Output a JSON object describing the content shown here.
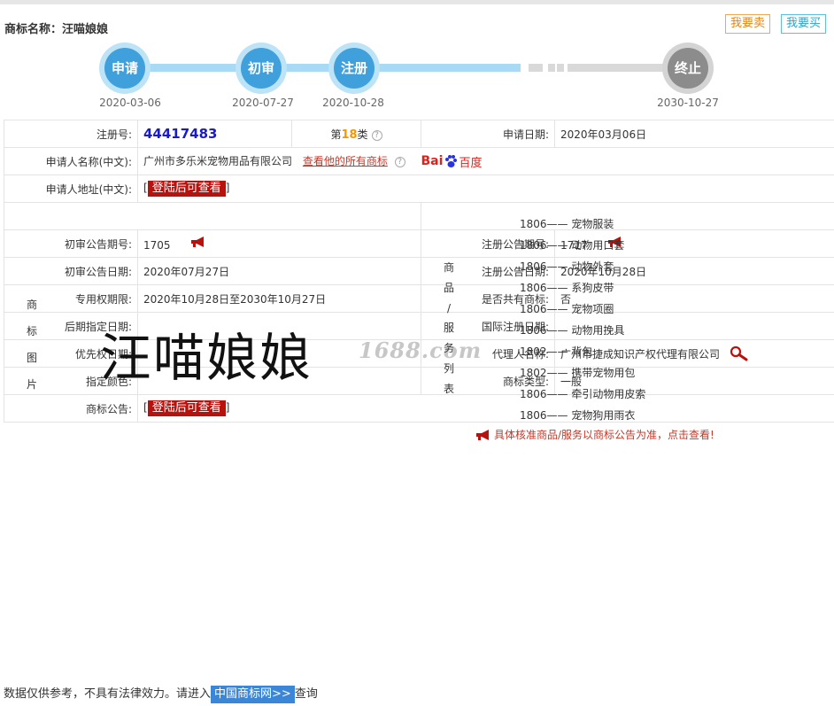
{
  "header": {
    "title": "商标名称：汪喵娘娘",
    "sell_label": "我要卖",
    "buy_label": "我要买"
  },
  "timeline": {
    "steps": [
      {
        "label": "申请",
        "date": "2020-03-06"
      },
      {
        "label": "初审",
        "date": "2020-07-27"
      },
      {
        "label": "注册",
        "date": "2020-10-28"
      },
      {
        "label": "终止",
        "date": "2030-10-27"
      }
    ]
  },
  "info": {
    "reg_no_label": "注册号:",
    "reg_no": "44417483",
    "class_prefix": "第",
    "class_num": "18",
    "class_suffix": "类",
    "apply_date_label": "申请日期:",
    "apply_date": "2020年03月06日",
    "applicant_label": "申请人名称(中文):",
    "applicant": "广州市多乐米宠物用品有限公司",
    "view_all_link": "查看他的所有商标",
    "baidu_bai": "Bai",
    "baidu_du": "百度",
    "address_label": "申请人地址(中文):",
    "login_label": "登陆后可查看",
    "bracket_open": "[",
    "bracket_close": "]"
  },
  "image_section": {
    "label_chars": [
      "商",
      "标",
      "图",
      "片"
    ],
    "brand_word": "汪喵娘娘",
    "watermark": "1688.com"
  },
  "goods_section": {
    "label_chars": [
      "商",
      "品",
      "/",
      "服",
      "务",
      "列",
      "表"
    ],
    "items": [
      {
        "code": "1806",
        "sep": "——",
        "name": "宠物服装"
      },
      {
        "code": "1806",
        "sep": "——",
        "name": "动物用口套"
      },
      {
        "code": "1806",
        "sep": "——",
        "name": "动物外套"
      },
      {
        "code": "1806",
        "sep": "——",
        "name": "系狗皮带"
      },
      {
        "code": "1806",
        "sep": "——",
        "name": "宠物项圈"
      },
      {
        "code": "1806",
        "sep": "——",
        "name": "动物用挽具"
      },
      {
        "code": "1802",
        "sep": "——",
        "name": "背包"
      },
      {
        "code": "1802",
        "sep": "——",
        "name": "携带宠物用包"
      },
      {
        "code": "1806",
        "sep": "——",
        "name": "牵引动物用皮索"
      },
      {
        "code": "1806",
        "sep": "——",
        "name": "宠物狗用雨衣"
      }
    ],
    "note": "具体核准商品/服务以商标公告为准，点击查看!"
  },
  "details": {
    "prelim_no_label": "初审公告期号:",
    "prelim_no": "1705",
    "reg_pub_no_label": "注册公告期号:",
    "reg_pub_no": "1717",
    "prelim_date_label": "初审公告日期:",
    "prelim_date": "2020年07月27日",
    "reg_pub_date_label": "注册公告日期:",
    "reg_pub_date": "2020年10月28日",
    "exclusive_label": "专用权期限:",
    "exclusive": "2020年10月28日至2030年10月27日",
    "shared_label": "是否共有商标:",
    "shared": "否",
    "later_label": "后期指定日期:",
    "later": "",
    "intl_label": "国际注册日期:",
    "intl": "",
    "priority_label": "优先权日期:",
    "priority": "",
    "agent_label": "代理人名称:",
    "agent": "广州市捷成知识产权代理有限公司",
    "color_label": "指定颜色:",
    "color": "",
    "type_label": "商标类型:",
    "type": "一般",
    "notice_label": "商标公告:"
  },
  "footer": {
    "prefix": "数据仅供参考，不具有法律效力。请进入",
    "link": "中国商标网>>",
    "suffix": "查询"
  },
  "colors": {
    "step_active": "#3fa0dc",
    "step_end": "#8c8c8c",
    "reg_no": "#1a1acc",
    "accent_red": "#b8120f",
    "class_orange": "#f39800"
  }
}
